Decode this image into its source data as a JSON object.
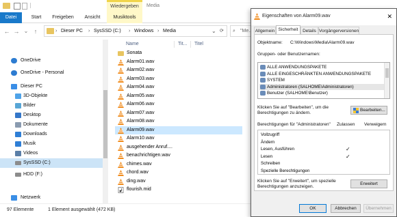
{
  "explorer": {
    "window_title": "Media",
    "context_tab": "Wiedergeben",
    "tabs": [
      "Datei",
      "Start",
      "Freigeben",
      "Ansicht",
      "Musiktools"
    ],
    "breadcrumb": [
      "Dieser PC",
      "SysSSD (C:)",
      "Windows",
      "Media"
    ],
    "search_placeholder": "\"Me...",
    "columns": [
      "Name",
      "Tit...",
      "Titel"
    ],
    "nav": {
      "items": [
        {
          "label": "OneDrive",
          "icon": "cloud-icon"
        },
        {
          "label": "OneDrive - Personal",
          "icon": "cloud-icon"
        },
        {
          "label": "Dieser PC",
          "icon": "pc-icon"
        },
        {
          "label": "3D-Objekte",
          "icon": "cube-icon"
        },
        {
          "label": "Bilder",
          "icon": "pictures-icon"
        },
        {
          "label": "Desktop",
          "icon": "desktop-icon"
        },
        {
          "label": "Dokumente",
          "icon": "documents-icon"
        },
        {
          "label": "Downloads",
          "icon": "download-icon"
        },
        {
          "label": "Musik",
          "icon": "music-icon"
        },
        {
          "label": "Videos",
          "icon": "video-icon"
        },
        {
          "label": "SysSSD (C:)",
          "icon": "drive-icon"
        },
        {
          "label": "HDD (F:)",
          "icon": "drive-icon"
        },
        {
          "label": "Netzwerk",
          "icon": "network-icon"
        }
      ]
    },
    "files": [
      {
        "name": "Sonata",
        "type": "folder"
      },
      {
        "name": "Alarm01.wav",
        "type": "audio"
      },
      {
        "name": "Alarm02.wav",
        "type": "audio"
      },
      {
        "name": "Alarm03.wav",
        "type": "audio"
      },
      {
        "name": "Alarm04.wav",
        "type": "audio"
      },
      {
        "name": "Alarm05.wav",
        "type": "audio"
      },
      {
        "name": "Alarm06.wav",
        "type": "audio"
      },
      {
        "name": "Alarm07.wav",
        "type": "audio"
      },
      {
        "name": "Alarm08.wav",
        "type": "audio"
      },
      {
        "name": "Alarm09.wav",
        "type": "audio",
        "selected": true
      },
      {
        "name": "Alarm10.wav",
        "type": "audio"
      },
      {
        "name": "ausgehender Anruf....",
        "type": "audio"
      },
      {
        "name": "benachrichtigen.wav",
        "type": "audio"
      },
      {
        "name": "chimes.wav",
        "type": "audio"
      },
      {
        "name": "chord.wav",
        "type": "audio"
      },
      {
        "name": "ding.wav",
        "type": "audio"
      },
      {
        "name": "flourish.mid",
        "type": "midi"
      }
    ],
    "status": {
      "count": "97 Elemente",
      "selection": "1 Element ausgewählt (472 KB)"
    }
  },
  "dialog": {
    "title": "Eigenschaften von Alarm09.wav",
    "tabs": [
      "Allgemein",
      "Sicherheit",
      "Details",
      "Vorgängerversionen"
    ],
    "active_tab": "Sicherheit",
    "object_label": "Objektname:",
    "object_value": "C:\\Windows\\Media\\Alarm09.wav",
    "groups_label": "Gruppen- oder Benutzernamen:",
    "groups": [
      "ALLE ANWENDUNGSPAKETE",
      "ALLE EINGESCHRÄNKTEN ANWENDUNGSPAKETE",
      "SYSTEM",
      "Administratoren (SALHOME\\Administratoren)",
      "Benutzer (SALHOME\\Benutzer)"
    ],
    "selected_group_index": 3,
    "edit_hint": "Klicken Sie auf \"Bearbeiten\", um die Berechtigungen zu ändern.",
    "edit_button": "Bearbeiten...",
    "perm_label": "Berechtigungen für \"Administratoren\"",
    "col_allow": "Zulassen",
    "col_deny": "Verweigern",
    "permissions": [
      {
        "name": "Vollzugriff",
        "allow": false,
        "deny": false
      },
      {
        "name": "Ändern",
        "allow": false,
        "deny": false
      },
      {
        "name": "Lesen, Ausführen",
        "allow": true,
        "deny": false
      },
      {
        "name": "Lesen",
        "allow": true,
        "deny": false
      },
      {
        "name": "Schreiben",
        "allow": false,
        "deny": false
      },
      {
        "name": "Spezielle Berechtigungen",
        "allow": false,
        "deny": false
      }
    ],
    "advanced_hint": "Klicken Sie auf \"Erweitert\", um spezielle Berechtigungen anzuzeigen.",
    "advanced_button": "Erweitert",
    "ok_button": "OK",
    "cancel_button": "Abbrechen",
    "apply_button": "Übernehmen",
    "close_glyph": "✕",
    "check_glyph": "✓"
  },
  "glyphs": {
    "back": "←",
    "forward": "→",
    "down": "⌄",
    "up": "↑",
    "chevron_right": "›",
    "search": "⌕",
    "expand": "›",
    "expanded": "⌄"
  }
}
